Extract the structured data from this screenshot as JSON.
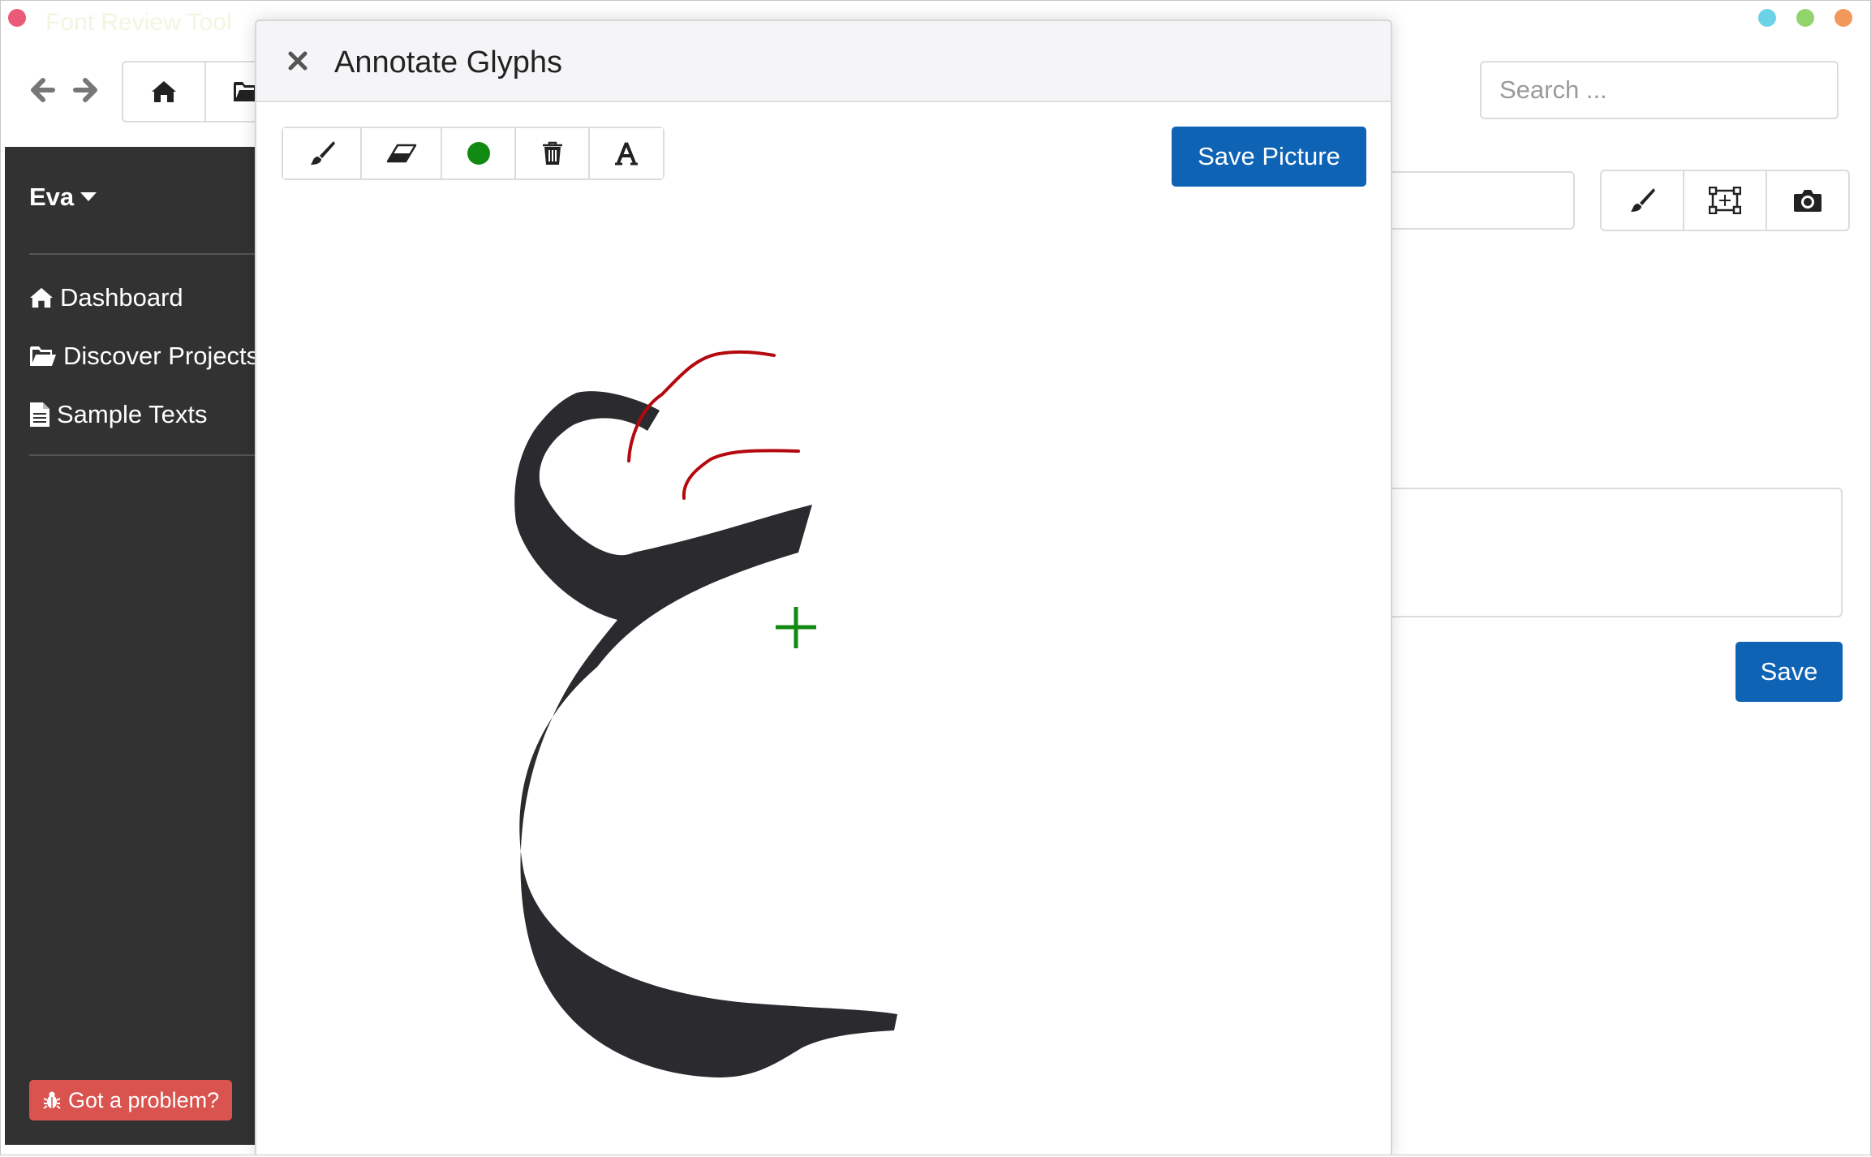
{
  "window": {
    "title": "Font Review Tool"
  },
  "toolbar": {
    "back_icon": "arrow-left-icon",
    "forward_icon": "arrow-right-icon",
    "home_icon": "home-icon",
    "folder_icon": "folder-open-icon"
  },
  "search": {
    "placeholder": "Search ..."
  },
  "sidebar": {
    "user": "Eva",
    "items": [
      {
        "label": "Dashboard",
        "icon": "home-icon"
      },
      {
        "label": "Discover Projects",
        "icon": "folder-open-icon"
      },
      {
        "label": "Sample Texts",
        "icon": "document-icon"
      }
    ],
    "problem_button": "Got a problem?"
  },
  "main": {
    "tools": [
      "brush-icon",
      "select-frame-icon",
      "camera-icon"
    ],
    "save_label": "Save"
  },
  "modal": {
    "title": "Annotate Glyphs",
    "tools": [
      "brush-icon",
      "eraser-icon",
      "color-dot-icon",
      "trash-icon",
      "text-icon"
    ],
    "save_label": "Save Picture",
    "glyph": "ع",
    "active_color": "#118a11",
    "annotation_color": "#b3090f"
  },
  "colors": {
    "sidebar_bg": "#323232",
    "primary": "#0e63b5",
    "danger": "#d9534f"
  }
}
